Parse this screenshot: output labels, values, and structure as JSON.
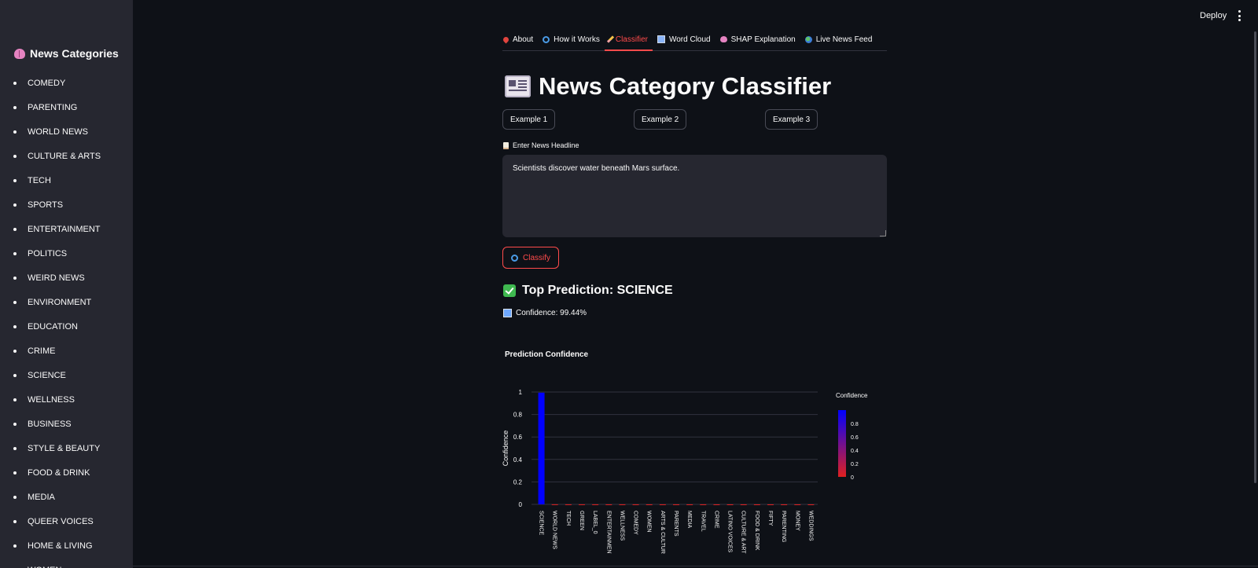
{
  "sidebar": {
    "title": "News Categories",
    "items": [
      "COMEDY",
      "PARENTING",
      "WORLD NEWS",
      "CULTURE & ARTS",
      "TECH",
      "SPORTS",
      "ENTERTAINMENT",
      "POLITICS",
      "WEIRD NEWS",
      "ENVIRONMENT",
      "EDUCATION",
      "CRIME",
      "SCIENCE",
      "WELLNESS",
      "BUSINESS",
      "STYLE & BEAUTY",
      "FOOD & DRINK",
      "MEDIA",
      "QUEER VOICES",
      "HOME & LIVING",
      "WOMEN"
    ]
  },
  "header": {
    "deploy_label": "Deploy"
  },
  "tabs": [
    {
      "label": "About",
      "icon": "pin-icon",
      "active": false
    },
    {
      "label": "How it Works",
      "icon": "magnifier-icon",
      "active": false
    },
    {
      "label": "Classifier",
      "icon": "pencil-icon",
      "active": true
    },
    {
      "label": "Word Cloud",
      "icon": "bar-chart-icon",
      "active": false
    },
    {
      "label": "SHAP Explanation",
      "icon": "brain-icon",
      "active": false
    },
    {
      "label": "Live News Feed",
      "icon": "globe-icon",
      "active": false
    }
  ],
  "title": "News Category Classifier",
  "examples": [
    "Example 1",
    "Example 2",
    "Example 3"
  ],
  "input": {
    "label": "Enter News Headline",
    "value": "Scientists discover water beneath Mars surface."
  },
  "classify_label": "Classify",
  "prediction": {
    "top": "Top Prediction: SCIENCE",
    "confidence": "Confidence: 99.44%"
  },
  "chart_title": "Prediction Confidence",
  "chart_data": {
    "type": "bar",
    "ylabel": "Confidence",
    "xlabel": "",
    "ylim": [
      0,
      1
    ],
    "yticks": [
      "0",
      "0.2",
      "0.4",
      "0.6",
      "0.8",
      "1"
    ],
    "categories": [
      "SCIENCE",
      "WORLD NEWS",
      "TECH",
      "GREEN",
      "LABEL_0",
      "ENTERTAINMENT",
      "WELLNESS",
      "COMEDY",
      "WOMEN",
      "ARTS & CULTURE",
      "PARENTS",
      "MEDIA",
      "TRAVEL",
      "CRIME",
      "LATINO VOICES",
      "CULTURE & ARTS",
      "FOOD & DRINK",
      "FIFTY",
      "PARENTING",
      "MONEY",
      "WEDDINGS"
    ],
    "values": [
      0.9944,
      0.0006,
      0.0005,
      0.0005,
      0.0004,
      0.0004,
      0.0004,
      0.0003,
      0.0003,
      0.0003,
      0.0003,
      0.0003,
      0.0003,
      0.0002,
      0.0002,
      0.0002,
      0.0002,
      0.0002,
      0.0002,
      0.0002,
      0.0002
    ],
    "colorbar": {
      "title": "Confidence",
      "ticks": [
        "0",
        "0.2",
        "0.4",
        "0.6",
        "0.8"
      ],
      "low_color": "#e02020",
      "high_color": "#0000ff"
    },
    "grid": true
  },
  "colors": {
    "accent": "#ff4b4b",
    "background": "#0e1117",
    "sidebar": "#262730"
  }
}
